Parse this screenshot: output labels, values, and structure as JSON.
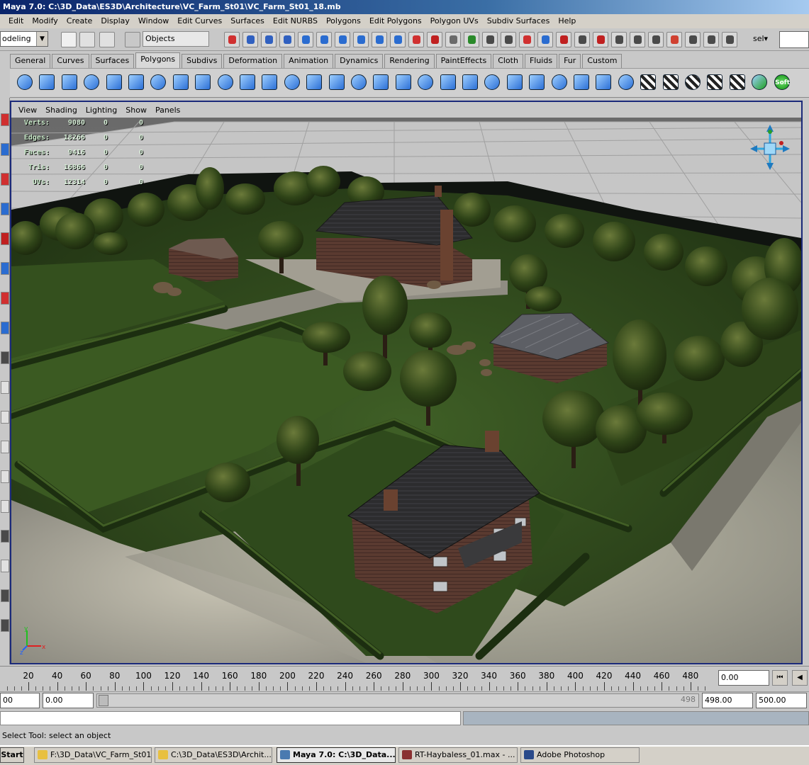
{
  "window": {
    "title": "Maya 7.0: C:\\3D_Data\\ES3D\\Architecture\\VC_Farm_St01\\VC_Farm_St01_18.mb"
  },
  "menubar": {
    "items": [
      "Edit",
      "Modify",
      "Create",
      "Display",
      "Window",
      "Edit Curves",
      "Surfaces",
      "Edit NURBS",
      "Polygons",
      "Edit Polygons",
      "Polygon UVs",
      "Subdiv Surfaces",
      "Help"
    ]
  },
  "statusline": {
    "mode": "odeling",
    "object_field": "Objects",
    "sel_label": "sel▾"
  },
  "shelf_tabs": [
    "General",
    "Curves",
    "Surfaces",
    "Polygons",
    "Subdivs",
    "Deformation",
    "Animation",
    "Dynamics",
    "Rendering",
    "PaintEffects",
    "Cloth",
    "Fluids",
    "Fur",
    "Custom"
  ],
  "shelf_active": "Polygons",
  "shelf": {
    "soft_label": "Soft"
  },
  "panel_menu": [
    "View",
    "Shading",
    "Lighting",
    "Show",
    "Panels"
  ],
  "hud": {
    "rows": [
      {
        "label": "Verts:",
        "v1": "9080",
        "v2": "0",
        "v3": "0"
      },
      {
        "label": "Edges:",
        "v1": "18266",
        "v2": "0",
        "v3": "0"
      },
      {
        "label": "Faces:",
        "v1": "9416",
        "v2": "0",
        "v3": "0"
      },
      {
        "label": "Tris:",
        "v1": "16866",
        "v2": "0",
        "v3": "0"
      },
      {
        "label": "UVs:",
        "v1": "12314",
        "v2": "0",
        "v3": "0"
      }
    ]
  },
  "timeline": {
    "ticks": [
      "20",
      "40",
      "60",
      "80",
      "100",
      "120",
      "140",
      "160",
      "180",
      "200",
      "220",
      "240",
      "260",
      "280",
      "300",
      "320",
      "340",
      "360",
      "380",
      "400",
      "420",
      "440",
      "460",
      "480"
    ],
    "current_frame": "0.00"
  },
  "range": {
    "start": "00",
    "start_inner": "0.00",
    "slider_end": "498",
    "end_inner": "498.00",
    "end": "500.00"
  },
  "helpline": "Select Tool: select an object",
  "taskbar": {
    "start": "Start",
    "tasks": [
      {
        "label": "F:\\3D_Data\\VC_Farm_St01",
        "active": false
      },
      {
        "label": "C:\\3D_Data\\ES3D\\Archit...",
        "active": false
      },
      {
        "label": "Maya 7.0: C:\\3D_Data...",
        "active": true
      },
      {
        "label": "RT-Haybaless_01.max - ...",
        "active": false
      },
      {
        "label": "Adobe Photoshop",
        "active": false
      }
    ]
  },
  "colors": {
    "title_bar": "#0a246a",
    "viewport_border": "#1b2a7a",
    "grass": "#2f4a1e",
    "shelf_icon_blue": "#2b6fd6"
  }
}
